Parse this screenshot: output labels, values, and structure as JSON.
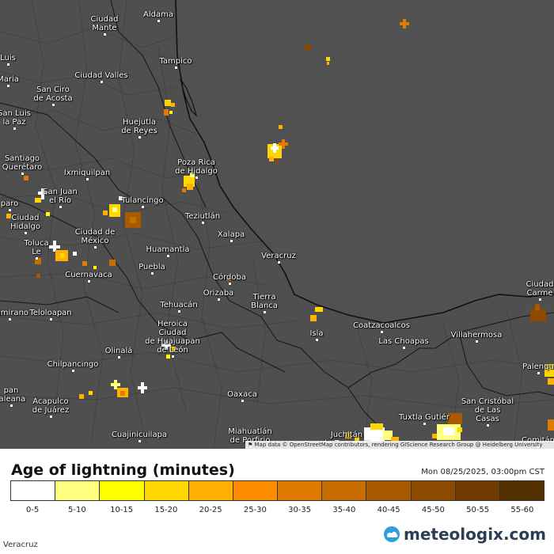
{
  "map": {
    "cities": [
      {
        "id": "aldama",
        "label": "Aldama"
      },
      {
        "id": "ciudad-mante",
        "label": "Ciudad\nMante"
      },
      {
        "id": "tampico",
        "label": "Tampico"
      },
      {
        "id": "luis",
        "label": "Luis"
      },
      {
        "id": "maria",
        "label": "Maria"
      },
      {
        "id": "ciudad-valles",
        "label": "Ciudad Valles"
      },
      {
        "id": "san-ciro",
        "label": "San Ciro\nde Acosta"
      },
      {
        "id": "san-luis-la-paz",
        "label": "San Luis\nla Paz"
      },
      {
        "id": "huejutla",
        "label": "Huejutla\nde Reyes"
      },
      {
        "id": "santiago-queretaro",
        "label": "Santiago\nQuerétaro"
      },
      {
        "id": "ixmiquilpan",
        "label": "Ixmiquilpan"
      },
      {
        "id": "poza-rica",
        "label": "Poza Rica\nde Hidalgo"
      },
      {
        "id": "san-juan-del-rio",
        "label": "San Juan\nel Río"
      },
      {
        "id": "tulancingo",
        "label": "Tulancingo"
      },
      {
        "id": "teziutlan",
        "label": "Teziutlán"
      },
      {
        "id": "ciudad-hidalgo",
        "label": "Ciudad\nHidalgo"
      },
      {
        "id": "paro",
        "label": "paro"
      },
      {
        "id": "ciudad-de-mexico",
        "label": "Ciudad de\nMéxico"
      },
      {
        "id": "xalapa",
        "label": "Xalapa"
      },
      {
        "id": "toluca",
        "label": "Toluca\nLe"
      },
      {
        "id": "huamantla",
        "label": "Huamantla"
      },
      {
        "id": "veracruz",
        "label": "Veracruz"
      },
      {
        "id": "puebla",
        "label": "Puebla"
      },
      {
        "id": "cuernavaca",
        "label": "Cuernavaca"
      },
      {
        "id": "cordoba",
        "label": "Córdoba"
      },
      {
        "id": "orizaba",
        "label": "Orizaba"
      },
      {
        "id": "tehuacan",
        "label": "Tehuacán"
      },
      {
        "id": "tierra-blanca",
        "label": "Tierra\nBlanca"
      },
      {
        "id": "ciudad-carmen",
        "label": "Ciudad\nCarme"
      },
      {
        "id": "teloloapan",
        "label": "Teloloapan"
      },
      {
        "id": "altamirano",
        "label": "ltamirano"
      },
      {
        "id": "heroica-huajuapan",
        "label": "Heroica\nCiudad\nde Huajuapan\nde León"
      },
      {
        "id": "coatzacoalcos",
        "label": "Coatzacoalcos"
      },
      {
        "id": "las-choapas",
        "label": "Las Choapas"
      },
      {
        "id": "villahermosa",
        "label": "Villahermosa"
      },
      {
        "id": "isla",
        "label": "Isla"
      },
      {
        "id": "iguala",
        "label": "Olinalá"
      },
      {
        "id": "chilpancingo",
        "label": "Chilpancingo"
      },
      {
        "id": "palenque",
        "label": "Palenqu"
      },
      {
        "id": "oaxaca",
        "label": "Oaxaca"
      },
      {
        "id": "zihuatanejo",
        "label": "pan\nlaleana"
      },
      {
        "id": "acapulco",
        "label": "Acapulco\nde Juárez"
      },
      {
        "id": "san-cristobal",
        "label": "San Cristóbal\nde Las\nCasas"
      },
      {
        "id": "tuxtla",
        "label": "Tuxtla Gutiér"
      },
      {
        "id": "cuajinicuilapa",
        "label": "Cuajinicuilapa"
      },
      {
        "id": "miahuatlan",
        "label": "Miahuatlán\nde Porfirio"
      },
      {
        "id": "juchitan",
        "label": "Juchitán\nde Zaragoza"
      },
      {
        "id": "comitan",
        "label": "Comitán"
      }
    ],
    "attribution": "Map data © OpenStreetMap contributors, rendering GIScience Research Group @ Heidelberg University"
  },
  "legend": {
    "title": "Age of lightning (minutes)",
    "timestamp": "Mon 08/25/2025, 03:00pm CST",
    "bins": [
      {
        "label": "0-5",
        "color": "#ffffff"
      },
      {
        "label": "5-10",
        "color": "#ffff80"
      },
      {
        "label": "10-15",
        "color": "#ffff00"
      },
      {
        "label": "15-20",
        "color": "#ffd700"
      },
      {
        "label": "20-25",
        "color": "#ffb000"
      },
      {
        "label": "25-30",
        "color": "#ff8c00"
      },
      {
        "label": "30-35",
        "color": "#e07a00"
      },
      {
        "label": "35-40",
        "color": "#c86e00"
      },
      {
        "label": "40-45",
        "color": "#a85a00"
      },
      {
        "label": "45-50",
        "color": "#8c4a00"
      },
      {
        "label": "50-55",
        "color": "#6e3a00"
      },
      {
        "label": "55-60",
        "color": "#553000"
      }
    ]
  },
  "footer": {
    "region": "Veracruz",
    "brand": "meteologix.com",
    "brand_icon": "meteologix-logo-icon"
  }
}
